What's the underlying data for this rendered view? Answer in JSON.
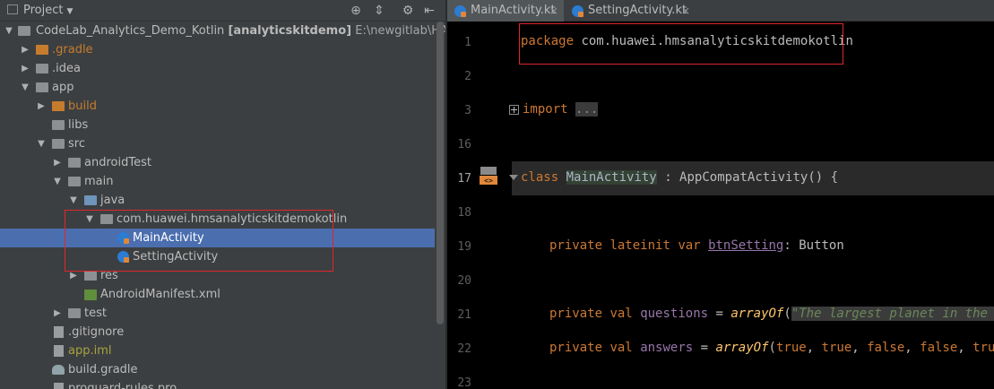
{
  "project_panel": {
    "title": "Project",
    "header_icons": [
      "target-icon",
      "collapse-icon",
      "gear-icon",
      "hide-icon"
    ],
    "tree": [
      {
        "label": "CodeLab_Analytics_Demo_Kotlin",
        "module": "[analyticskitdemo]",
        "path": "E:\\newgitlab\\HA_CodeLab",
        "level": 0,
        "expanded": true,
        "icon": "folder"
      },
      {
        "label": ".gradle",
        "level": 1,
        "expanded": false,
        "icon": "folder-orange",
        "color": "orange"
      },
      {
        "label": ".idea",
        "level": 1,
        "expanded": false,
        "icon": "folder"
      },
      {
        "label": "app",
        "level": 1,
        "expanded": true,
        "icon": "module-folder"
      },
      {
        "label": "build",
        "level": 2,
        "expanded": false,
        "icon": "folder-orange",
        "color": "orange"
      },
      {
        "label": "libs",
        "level": 2,
        "icon": "folder"
      },
      {
        "label": "src",
        "level": 2,
        "expanded": true,
        "icon": "folder"
      },
      {
        "label": "androidTest",
        "level": 3,
        "expanded": false,
        "icon": "folder"
      },
      {
        "label": "main",
        "level": 3,
        "expanded": true,
        "icon": "folder"
      },
      {
        "label": "java",
        "level": 4,
        "expanded": true,
        "icon": "folder-blue"
      },
      {
        "label": "com.huawei.hmsanalyticskitdemokotlin",
        "level": 5,
        "expanded": true,
        "icon": "package"
      },
      {
        "label": "MainActivity",
        "level": 6,
        "icon": "kotlin-class",
        "selected": true
      },
      {
        "label": "SettingActivity",
        "level": 6,
        "icon": "kotlin-class"
      },
      {
        "label": "res",
        "level": 4,
        "expanded": false,
        "icon": "folder"
      },
      {
        "label": "AndroidManifest.xml",
        "level": 4,
        "icon": "manifest"
      },
      {
        "label": "test",
        "level": 3,
        "expanded": false,
        "icon": "folder"
      },
      {
        "label": ".gitignore",
        "level": 2,
        "icon": "file"
      },
      {
        "label": "app.iml",
        "level": 2,
        "icon": "file",
        "color": "yellow"
      },
      {
        "label": "build.gradle",
        "level": 2,
        "icon": "gradle"
      },
      {
        "label": "proguard-rules.pro",
        "level": 2,
        "icon": "file"
      }
    ]
  },
  "editor": {
    "tabs": [
      {
        "label": "MainActivity.kt",
        "active": true
      },
      {
        "label": "SettingActivity.kt",
        "active": false
      }
    ],
    "lines": [
      {
        "num": "1",
        "text": "package com.huawei.hmsanalyticskitdemokotlin"
      },
      {
        "num": "2",
        "text": ""
      },
      {
        "num": "3",
        "text": "import ..."
      },
      {
        "num": "16",
        "text": ""
      },
      {
        "num": "17",
        "text": "class MainActivity : AppCompatActivity() {"
      },
      {
        "num": "18",
        "text": ""
      },
      {
        "num": "19",
        "text": "private lateinit var btnSetting: Button"
      },
      {
        "num": "20",
        "text": ""
      },
      {
        "num": "21",
        "text": "private val questions = arrayOf(\"The largest planet in the sol"
      },
      {
        "num": "22",
        "text": "private val answers = arrayOf(true, true, false, false, true)"
      },
      {
        "num": "23",
        "text": ""
      }
    ],
    "tokens": {
      "package_kw": "package",
      "package_name": "com.huawei.hmsanalyticskitdemokotlin",
      "import_kw": "import",
      "import_fold": "...",
      "class_kw": "class",
      "class_name": "MainActivity",
      "class_rest": ": AppCompatActivity() {",
      "private": "private",
      "lateinit": "lateinit",
      "var": "var",
      "btnSetting": "btnSetting",
      "btn_type": ": Button",
      "val": "val",
      "questions": "questions",
      "eq": "=",
      "arrayOf": "arrayOf",
      "paren_open": "(",
      "questions_str": "\"The largest planet in the sol",
      "answers": "answers",
      "answers_vals": "true, true, false, false, true",
      "true": "true",
      "false": "false",
      "comma": ", ",
      "paren_close": ")"
    }
  }
}
